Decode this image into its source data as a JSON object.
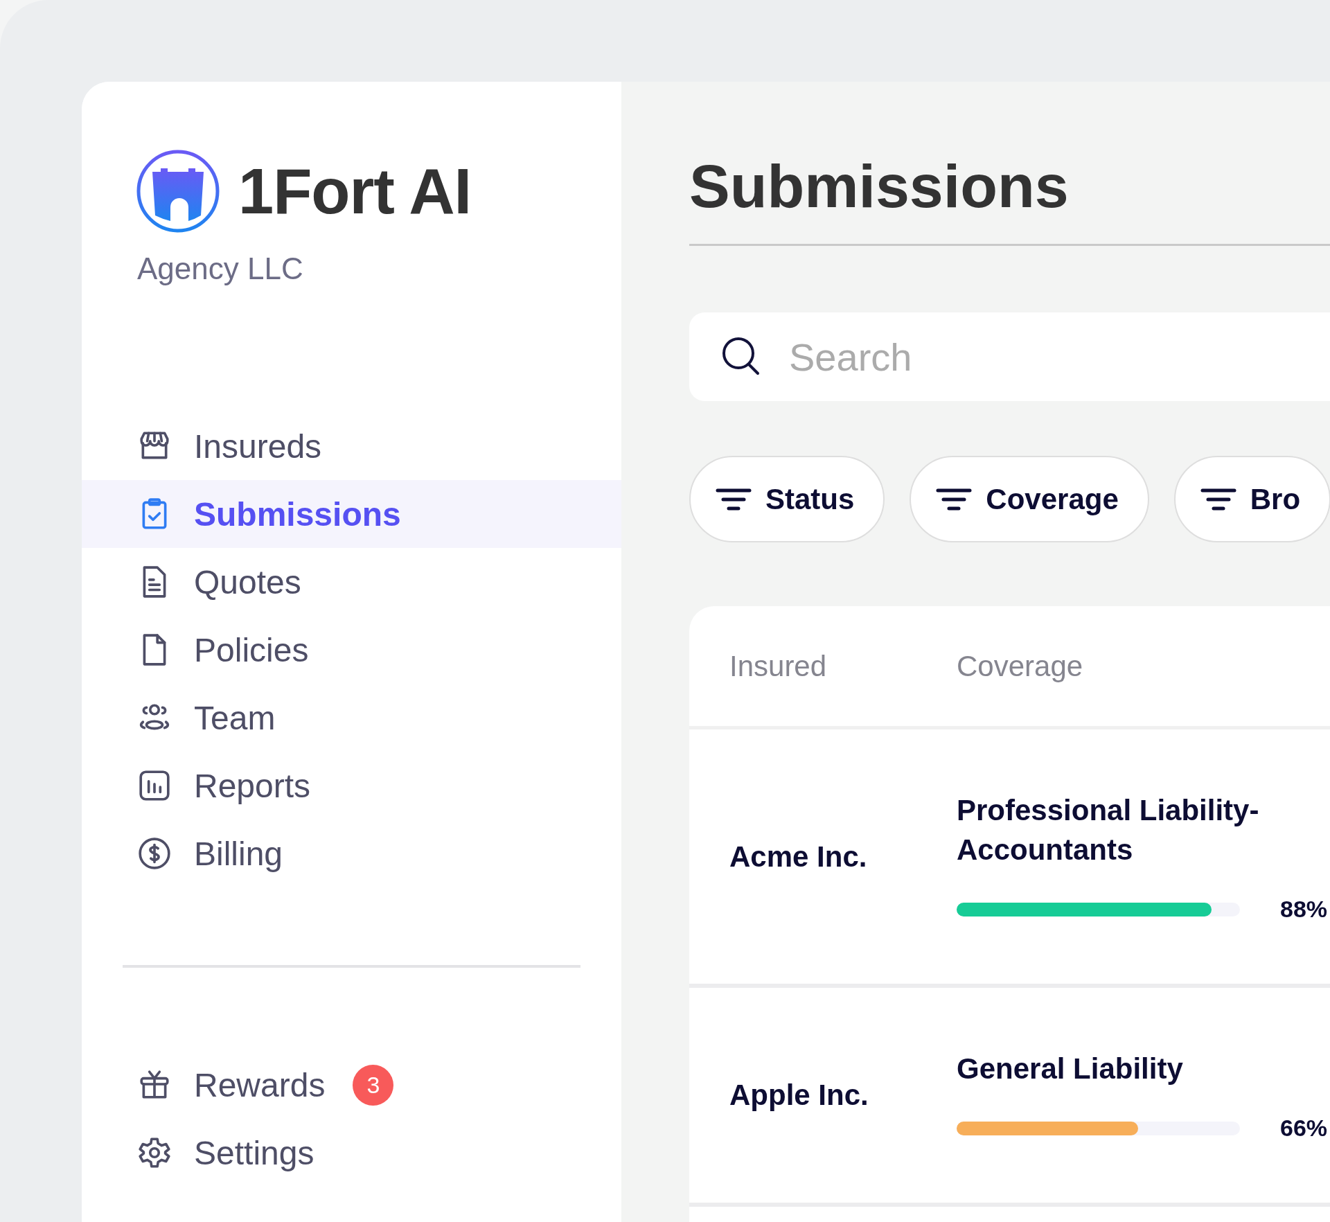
{
  "brand": {
    "name": "1Fort AI",
    "subtitle": "Agency LLC"
  },
  "sidebar": {
    "items": [
      {
        "label": "Insureds",
        "selected": false
      },
      {
        "label": "Submissions",
        "selected": true
      },
      {
        "label": "Quotes",
        "selected": false
      },
      {
        "label": "Policies",
        "selected": false
      },
      {
        "label": "Team",
        "selected": false
      },
      {
        "label": "Reports",
        "selected": false
      },
      {
        "label": "Billing",
        "selected": false
      }
    ],
    "footer_items": [
      {
        "label": "Rewards",
        "selected": false,
        "badge": "3"
      },
      {
        "label": "Settings",
        "selected": false
      }
    ]
  },
  "page": {
    "title": "Submissions"
  },
  "search": {
    "placeholder": "Search"
  },
  "filters": [
    "Status",
    "Coverage",
    "Bro"
  ],
  "table": {
    "columns": [
      "Insured",
      "Coverage"
    ],
    "rows": [
      {
        "insured": "Acme Inc.",
        "coverage": "Professional Liability-Accountants",
        "level": 0.9,
        "reading": "88%",
        "color": "#16cc96"
      },
      {
        "insured": "Apple Inc.",
        "coverage": "General Liability",
        "level": 0.64,
        "reading": "66%",
        "color": "#f7ae59"
      }
    ]
  }
}
